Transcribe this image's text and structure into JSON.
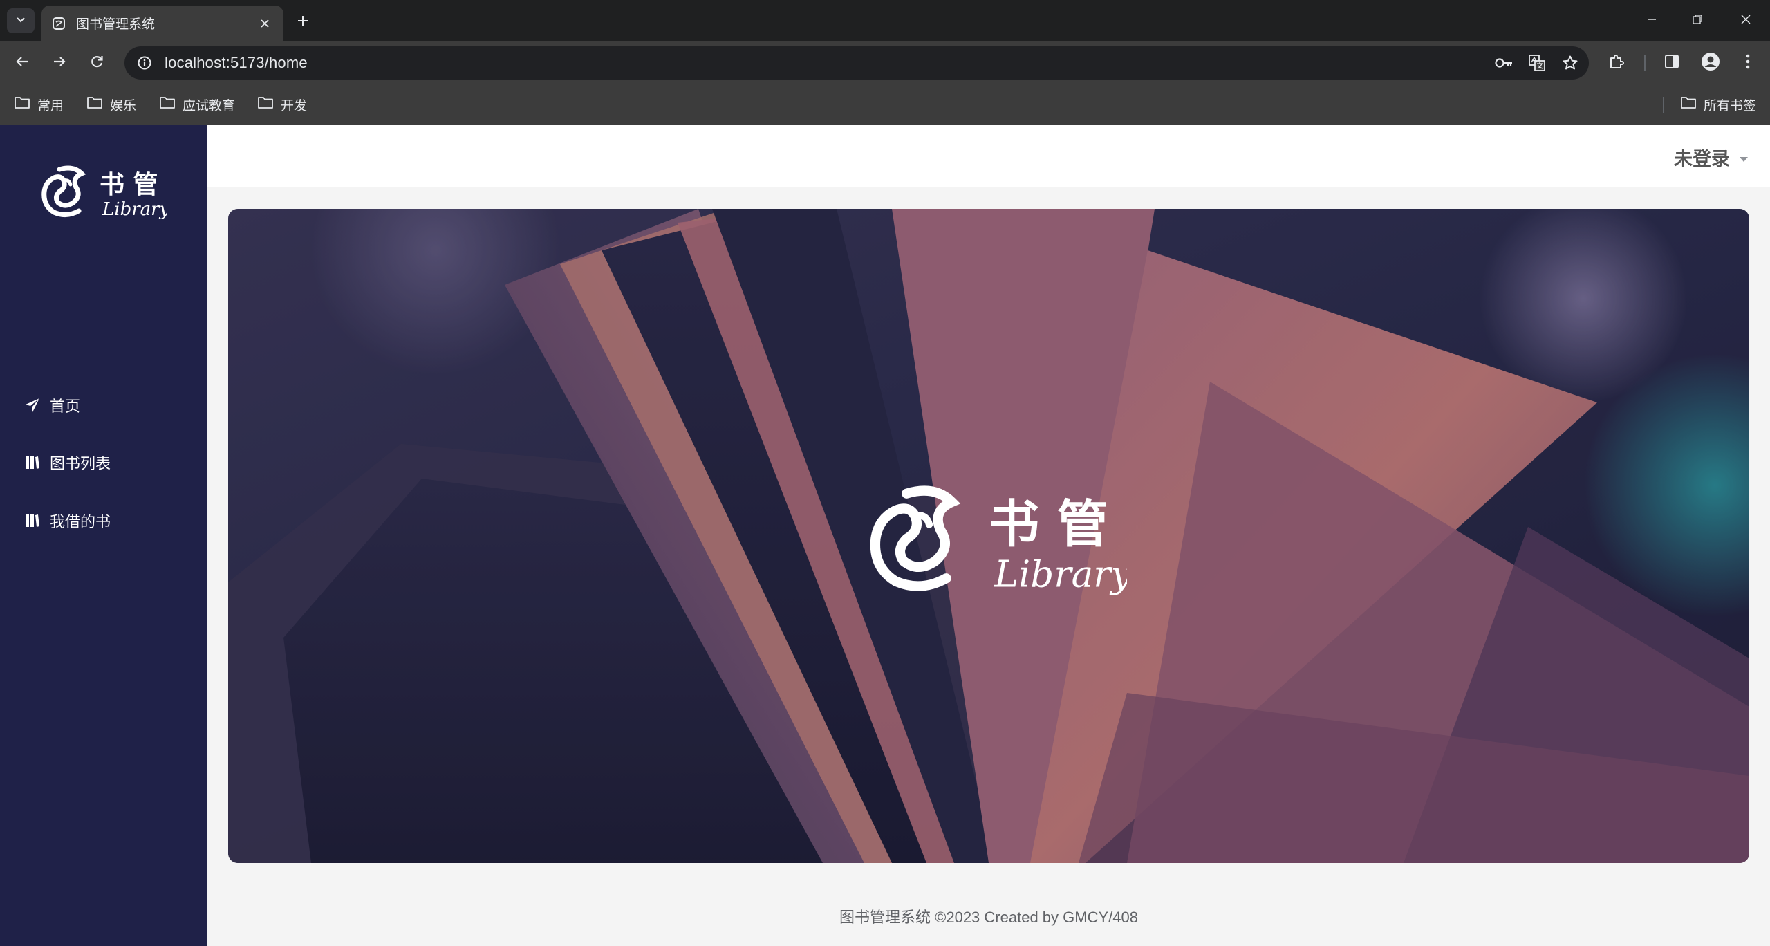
{
  "browser": {
    "tab_title": "图书管理系统",
    "url": "localhost:5173/home",
    "bookmarks": [
      {
        "label": "常用"
      },
      {
        "label": "娱乐"
      },
      {
        "label": "应试教育"
      },
      {
        "label": "开发"
      }
    ],
    "all_bookmarks_label": "所有书签"
  },
  "app": {
    "logo": {
      "chars": "书 管",
      "script": "Library"
    },
    "menu": [
      {
        "label": "首页",
        "icon": "paper-plane-icon"
      },
      {
        "label": "图书列表",
        "icon": "books-icon"
      },
      {
        "label": "我借的书",
        "icon": "books-icon"
      }
    ],
    "user_label": "未登录",
    "footer": "图书管理系统 ©2023 Created by GMCY/408",
    "colors": {
      "sidebar": "#1f2148",
      "header": "#ffffff",
      "content_bg": "#f4f4f4"
    }
  }
}
